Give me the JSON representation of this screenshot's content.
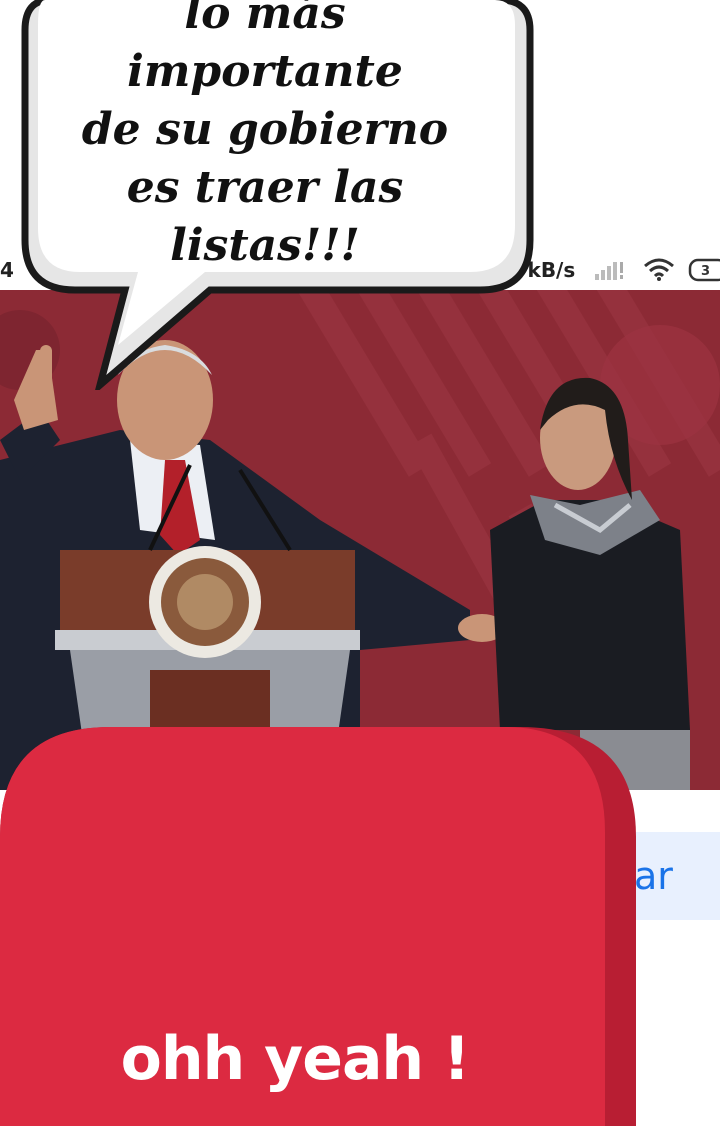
{
  "status_bar": {
    "time": "4",
    "network_speed": ".7kB/s",
    "battery_level": "3"
  },
  "speech_bubble": {
    "lines": [
      "lo más importante",
      "de su gobierno",
      "es traer las listas!!!"
    ]
  },
  "browser": {
    "button_fragment": "ar"
  },
  "red_card": {
    "text": "ohh yeah !"
  },
  "colors": {
    "backdrop_red": "#8c2a35",
    "card_red": "#dc2a41",
    "card_shadow": "#b81e33",
    "link_blue": "#1a73e8",
    "chip_bg": "#e8f0fe"
  },
  "icons": [
    "signal-icon",
    "wifi-icon",
    "battery-icon"
  ]
}
